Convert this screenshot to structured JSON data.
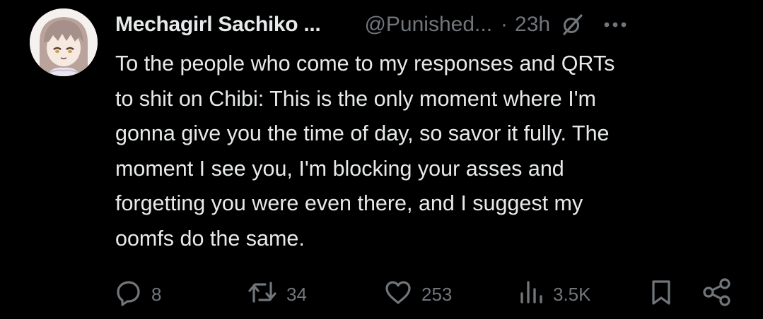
{
  "author": {
    "display_name": "Mechagirl Sachiko ...",
    "handle": "@Punished...",
    "separator": "·",
    "timestamp": "23h"
  },
  "tweet": {
    "text": "To the people who come to my responses and QRTs\nto shit on Chibi: This is the only moment where I'm\ngonna give you the time of day, so savor it fully. The\nmoment I see you, I'm blocking your asses and\nforgetting you were even there, and I suggest my\noomfs do the same."
  },
  "actions": {
    "replies": "8",
    "reposts": "34",
    "likes": "253",
    "views": "3.5K"
  },
  "icons": {
    "header": [
      "grok-icon",
      "more-icon"
    ],
    "actions": [
      "reply-icon",
      "repost-icon",
      "like-icon",
      "views-icon",
      "bookmark-icon",
      "share-icon"
    ]
  },
  "colors": {
    "background": "#000000",
    "primary_text": "#e7e9ea",
    "secondary_text": "#71767b"
  }
}
